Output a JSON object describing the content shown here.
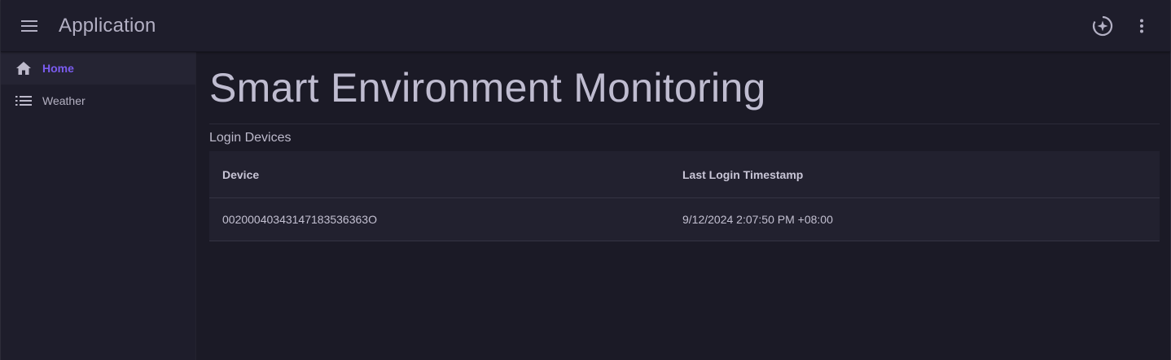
{
  "app": {
    "title": "Application"
  },
  "appbar": {
    "menu_icon": "menu-icon",
    "actions": [
      "brightness-icon",
      "more-vert-icon"
    ]
  },
  "sidebar": {
    "items": [
      {
        "label": "Home",
        "icon": "home-icon",
        "active": true
      },
      {
        "label": "Weather",
        "icon": "list-icon",
        "active": false
      }
    ]
  },
  "main": {
    "title": "Smart Environment Monitoring",
    "section_title": "Login Devices",
    "table": {
      "columns": [
        "Device",
        "Last Login Timestamp"
      ],
      "rows": [
        [
          "00200040343147183536363O",
          "9/12/2024 2:07:50 PM +08:00"
        ]
      ]
    }
  },
  "colors": {
    "background": "#1b1a26",
    "surface": "#1e1d2b",
    "accent": "#7b5cf0"
  }
}
